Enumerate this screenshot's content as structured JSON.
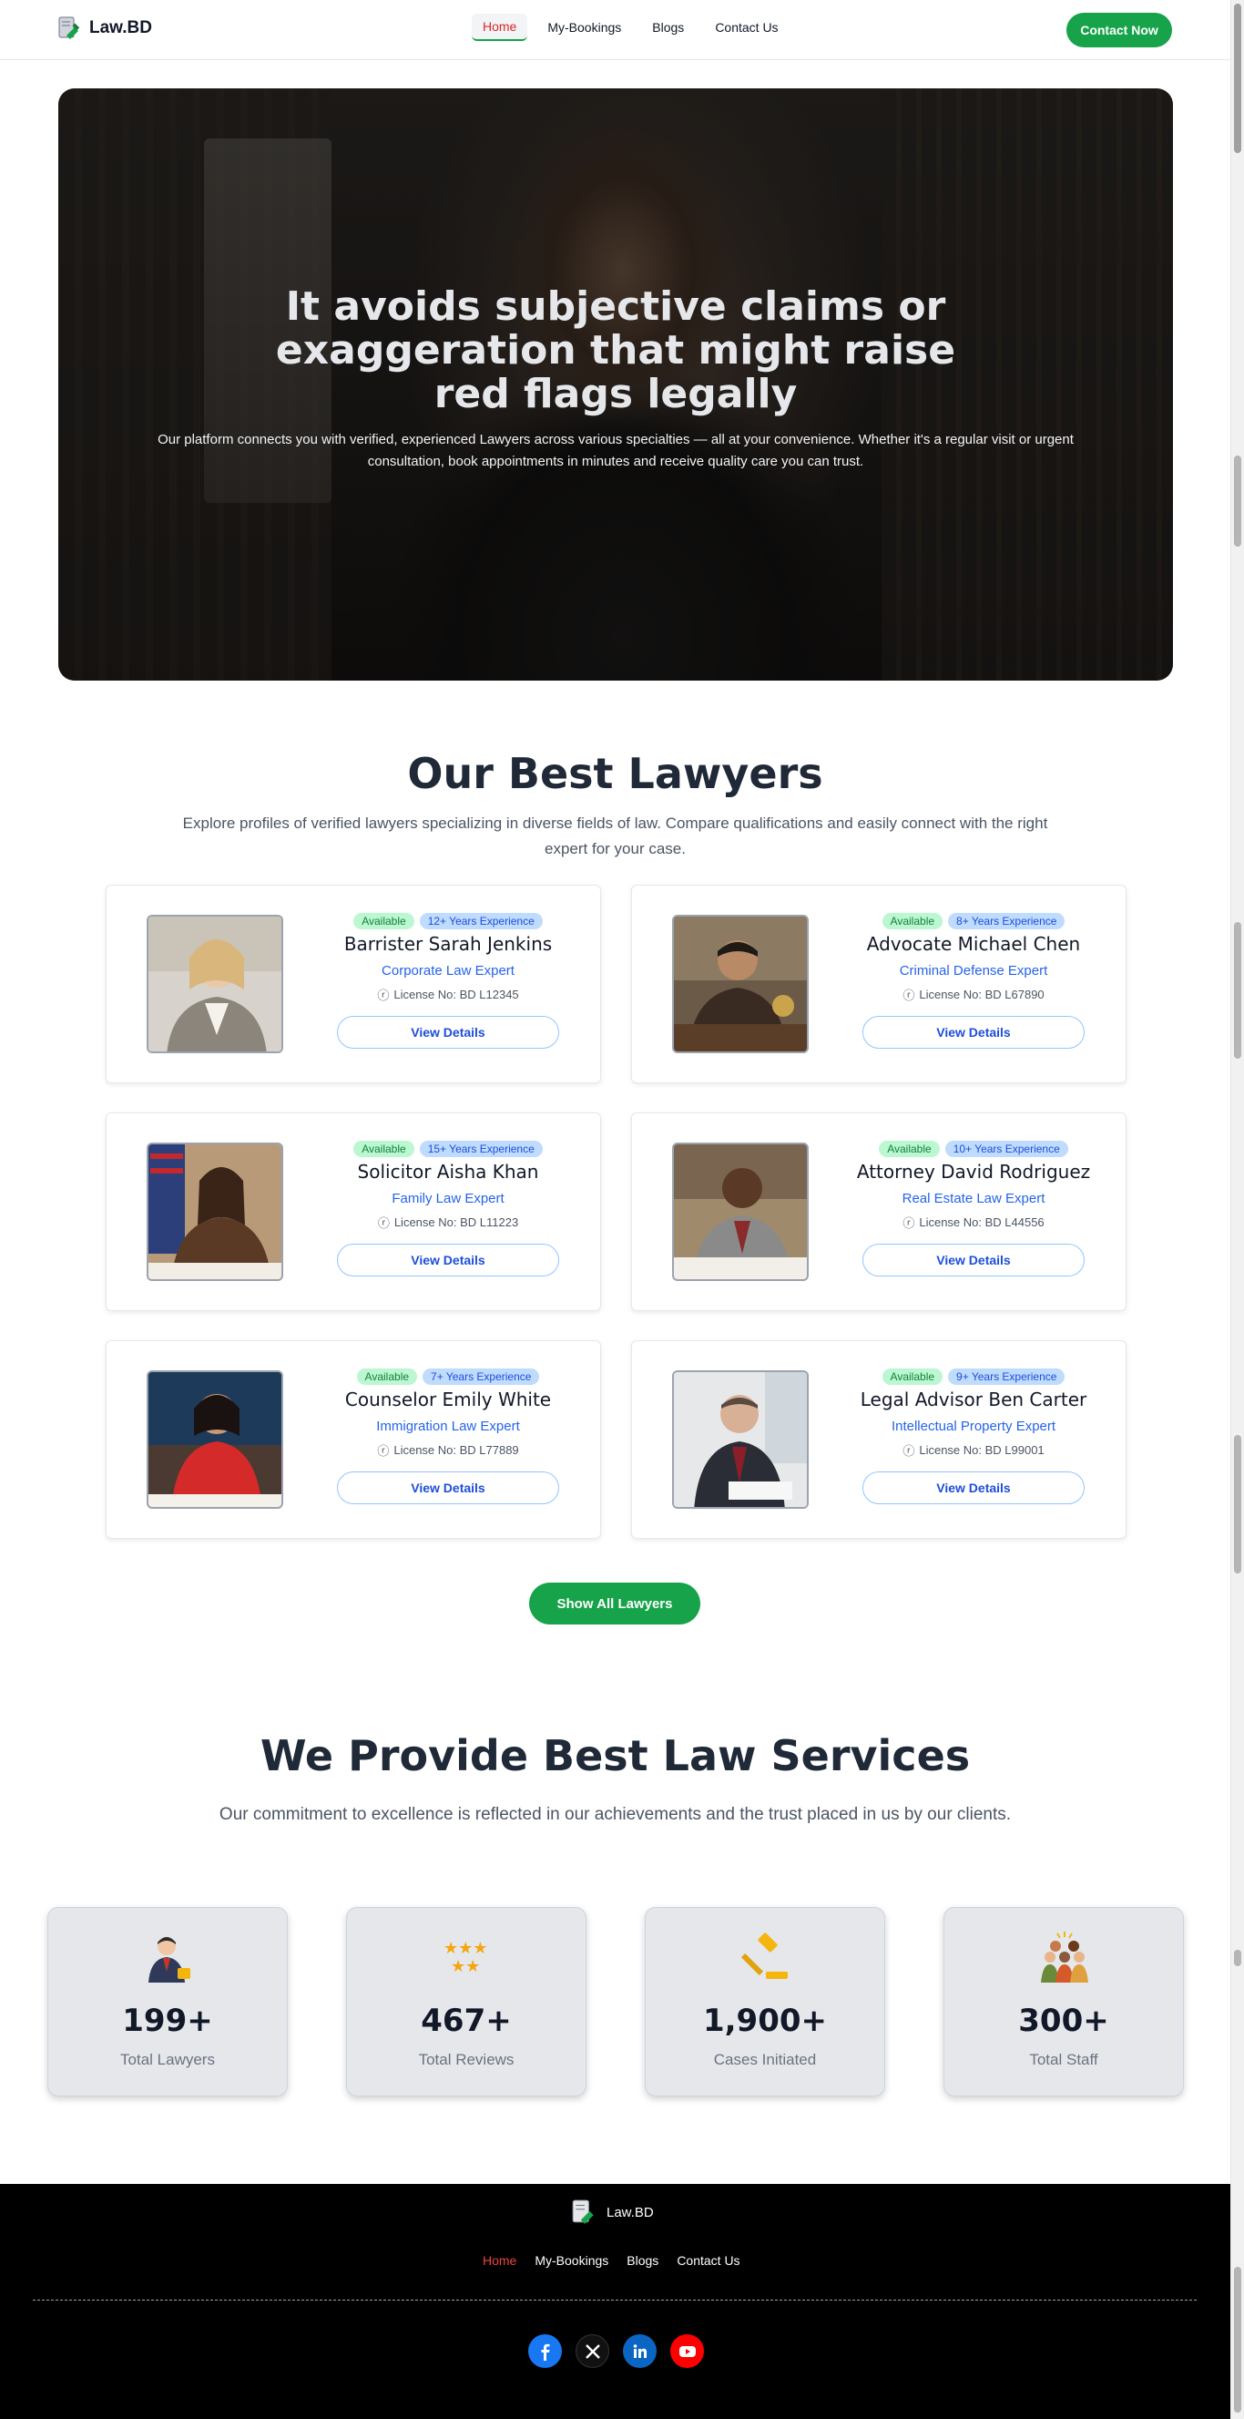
{
  "navbar": {
    "brand": "Law.BD",
    "links": [
      "Home",
      "My-Bookings",
      "Blogs",
      "Contact Us"
    ],
    "active_link": "Home",
    "cta": "Contact Now"
  },
  "hero": {
    "title": "It avoids subjective claims or exaggeration that might raise red flags legally",
    "description": "Our platform connects you with verified, experienced Lawyers across various specialties — all at your convenience. Whether it's a regular visit or urgent consultation, book appointments in minutes and receive quality care you can trust."
  },
  "lawyers_section": {
    "title": "Our Best Lawyers",
    "description": "Explore profiles of verified lawyers specializing in diverse fields of law. Compare qualifications and easily connect with the right expert for your case.",
    "show_all": "Show All Lawyers",
    "cards": [
      {
        "status": "Available",
        "experience": "12+ Years Experience",
        "name": "Barrister Sarah Jenkins",
        "specialty": "Corporate Law Expert",
        "license": "License No: BD L12345",
        "button": "View Details"
      },
      {
        "status": "Available",
        "experience": "8+ Years Experience",
        "name": "Advocate Michael Chen",
        "specialty": "Criminal Defense Expert",
        "license": "License No: BD L67890",
        "button": "View Details"
      },
      {
        "status": "Available",
        "experience": "15+ Years Experience",
        "name": "Solicitor Aisha Khan",
        "specialty": "Family Law Expert",
        "license": "License No: BD L11223",
        "button": "View Details"
      },
      {
        "status": "Available",
        "experience": "10+ Years Experience",
        "name": "Attorney David Rodriguez",
        "specialty": "Real Estate Law Expert",
        "license": "License No: BD L44556",
        "button": "View Details"
      },
      {
        "status": "Available",
        "experience": "7+ Years Experience",
        "name": "Counselor Emily White",
        "specialty": "Immigration Law Expert",
        "license": "License No: BD L77889",
        "button": "View Details"
      },
      {
        "status": "Available",
        "experience": "9+ Years Experience",
        "name": "Legal Advisor Ben Carter",
        "specialty": "Intellectual Property Expert",
        "license": "License No: BD L99001",
        "button": "View Details"
      }
    ]
  },
  "services_section": {
    "title": "We Provide Best Law Services",
    "description": "Our commitment to excellence is reflected in our achievements and the trust placed in us by our clients.",
    "stats": [
      {
        "value": "199+",
        "label": "Total Lawyers",
        "icon": "lawyer-icon"
      },
      {
        "value": "467+",
        "label": "Total Reviews",
        "icon": "stars-icon"
      },
      {
        "value": "1,900+",
        "label": "Cases Initiated",
        "icon": "gavel-icon"
      },
      {
        "value": "300+",
        "label": "Total Staff",
        "icon": "staff-icon"
      }
    ]
  },
  "footer": {
    "brand": "Law.BD",
    "links": [
      "Home",
      "My-Bookings",
      "Blogs",
      "Contact Us"
    ],
    "active_link": "Home",
    "socials": [
      "facebook-icon",
      "x-icon",
      "linkedin-icon",
      "youtube-icon"
    ]
  },
  "colors": {
    "primary_green": "#16a34a",
    "active_red": "#dc2626",
    "link_blue": "#2563eb"
  }
}
